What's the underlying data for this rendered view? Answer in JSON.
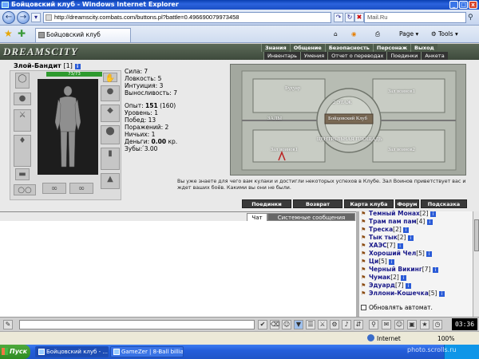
{
  "window": {
    "title": "Бойцовский клуб - Windows Internet Explorer",
    "minimize": "_",
    "maximize": "□",
    "close": "x"
  },
  "browser": {
    "address": "http://dreamscity.combats.com/buttons.pl?battle=0.496690079973458",
    "search_value": "Mail.Ru",
    "tab_title": "Бойцовский клуб",
    "toolbar": {
      "page": "Page",
      "tools": "Tools"
    }
  },
  "game": {
    "logo": "DREAMSCITY",
    "nav_top": [
      "Знания",
      "Общение",
      "Безопасность",
      "Персонаж",
      "Выход"
    ],
    "nav_bottom": [
      "Инвентарь",
      "Умения",
      "Отчет о переводах",
      "Поединки",
      "Анкета"
    ],
    "character": {
      "name": "Злой-Бандит",
      "level": "[1]",
      "hp": "73/73"
    },
    "stats": [
      {
        "label": "Сила:",
        "value": "7"
      },
      {
        "label": "Ловкость:",
        "value": "5"
      },
      {
        "label": "Интуиция:",
        "value": "3"
      },
      {
        "label": "Выносливость:",
        "value": "7"
      }
    ],
    "stats2": [
      {
        "label": "Опыт:",
        "value": "151",
        "extra": "(160)"
      },
      {
        "label": "Уровень:",
        "value": "1"
      },
      {
        "label": "Побед:",
        "value": "13"
      },
      {
        "label": "Поражений:",
        "value": "2"
      },
      {
        "label": "Ничьих:",
        "value": "1"
      }
    ],
    "money": {
      "label": "Деньги:",
      "value": "0.00",
      "unit": "кр."
    },
    "teeth": {
      "label": "Зубы:",
      "value": "́3.00"
    },
    "map_labels": {
      "boudoir": "Будуар",
      "hall1": "Зал воинов1",
      "floor2": "2 ЭТАЖ",
      "club": "Бойцовский Клуб",
      "halls": "ЗАЛЫ",
      "central": "ЦЕНТРАЛЬНАЯ ПЛОЩАДЬ",
      "hall_left": "Зал воинов1",
      "hall_right": "Зал воинов2"
    },
    "welcome": "Вы уже знаете для чего вам кулаки и достигли некоторых успехов в Клубе. Зал Воинов приветствует вас и ждет ваших боёв. Какими вы они не были.",
    "actions": [
      "Поединки",
      "Возврат",
      "Карта клуба",
      "Форум",
      "Подсказка"
    ]
  },
  "chat": {
    "tab_chat": "Чат",
    "tab_system": "Системные сообщения",
    "users": [
      {
        "name": "Темный Монах",
        "level": "[2]"
      },
      {
        "name": "Трам пам пам",
        "level": "[4]"
      },
      {
        "name": "Треска",
        "level": "[2]"
      },
      {
        "name": "Тык тык",
        "level": "[2]"
      },
      {
        "name": "ХАЭС",
        "level": "[7]"
      },
      {
        "name": "Хороший Чел",
        "level": "[5]"
      },
      {
        "name": "Ци",
        "level": "[5]"
      },
      {
        "name": "Черный Викинг",
        "level": "[7]"
      },
      {
        "name": "Чумак",
        "level": "[2]"
      },
      {
        "name": "Эдуард",
        "level": "[7]"
      },
      {
        "name": "Эллони-Кошечка",
        "level": "[5]"
      }
    ],
    "auto_refresh": "Обновлять автомат."
  },
  "clock": "03:36",
  "status": {
    "zone": "Internet",
    "zoom": "100%"
  },
  "taskbar": {
    "start": "Пуск",
    "items": [
      "Бойцовский клуб - ...",
      "GameZer | 8-Ball billiards..."
    ]
  },
  "watermark": "photo.scrolls.ru",
  "colors": {
    "ie_blue": "#245edb",
    "hp_green": "#2f9a2f",
    "game_dark": "#3a3a3a"
  }
}
